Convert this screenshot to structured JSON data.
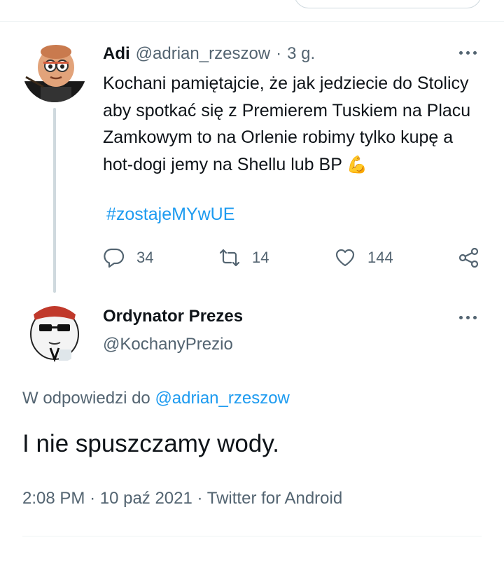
{
  "tweet": {
    "name": "Adi",
    "handle": "@adrian_rzeszow",
    "separator": "·",
    "time": "3 g.",
    "text": "Kochani pamiętajcie, że jak jedziecie do Stolicy aby spotkać się z Premierem Tuskiem na Placu Zamkowym to na Orlenie robimy tylko kupę a hot-dogi jemy na Shellu lub BP",
    "emoji": "💪",
    "hashtag": "#zostajeMYwUE",
    "replies": "34",
    "retweets": "14",
    "likes": "144"
  },
  "reply": {
    "name": "Ordynator Prezes",
    "handle": "@KochanyPrezio",
    "reply_prefix": "W odpowiedzi do",
    "reply_handle": "@adrian_rzeszow",
    "text": "I nie spuszczamy wody.",
    "time": "2:08 PM",
    "separator": "·",
    "date": "10 paź 2021",
    "source": "Twitter for Android"
  },
  "icons": {
    "reply": "speech-bubble-icon",
    "retweet": "retweet-arrows-icon",
    "like": "heart-icon",
    "share": "share-nodes-icon",
    "more": "more-dots-icon"
  },
  "colors": {
    "link": "#1d9bf0",
    "muted": "#536471",
    "text": "#0f1419",
    "border": "#cfd9de"
  }
}
